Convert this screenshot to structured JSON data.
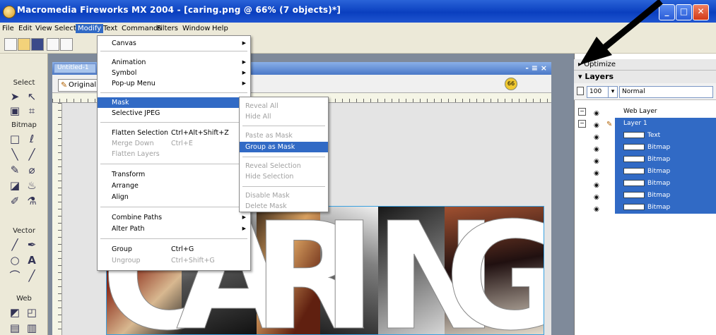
{
  "window": {
    "title": "Macromedia Fireworks MX 2004 - [caring.png @ 66% (7 objects)*]",
    "buttons": {
      "minimize": "_",
      "maximize": "□",
      "close": "✕"
    }
  },
  "menubar": [
    "File",
    "Edit",
    "View",
    "Select",
    "Modify",
    "Text",
    "Commands",
    "Filters",
    "Window",
    "Help"
  ],
  "tools": {
    "headings": {
      "select": "Select",
      "bitmap": "Bitmap",
      "vector": "Vector",
      "web": "Web"
    },
    "text_tool_glyph": "A"
  },
  "document": {
    "tab": "Untitled-1",
    "original_tab": "Original",
    "window_buttons": "- ≡ ×",
    "zoom_icon": "66",
    "artwork_text": [
      "C",
      "A",
      "R",
      "I",
      "N",
      "G"
    ]
  },
  "modify_menu": [
    {
      "label": "Canvas",
      "submenu": true
    },
    {
      "label": "Animation",
      "submenu": true
    },
    {
      "label": "Symbol",
      "submenu": true
    },
    {
      "label": "Pop-up Menu",
      "submenu": true
    },
    {
      "label": "Mask",
      "submenu": true,
      "highlighted": true
    },
    {
      "label": "Selective JPEG",
      "submenu": true
    },
    {
      "label": "Flatten Selection",
      "shortcut": "Ctrl+Alt+Shift+Z"
    },
    {
      "label": "Merge Down",
      "shortcut": "Ctrl+E",
      "disabled": true
    },
    {
      "label": "Flatten Layers",
      "disabled": true
    },
    {
      "label": "Transform",
      "submenu": true
    },
    {
      "label": "Arrange",
      "submenu": true
    },
    {
      "label": "Align",
      "submenu": true
    },
    {
      "label": "Combine Paths",
      "submenu": true
    },
    {
      "label": "Alter Path",
      "submenu": true
    },
    {
      "label": "Group",
      "shortcut": "Ctrl+G"
    },
    {
      "label": "Ungroup",
      "shortcut": "Ctrl+Shift+G",
      "disabled": true
    }
  ],
  "mask_menu": [
    {
      "label": "Reveal All",
      "disabled": true
    },
    {
      "label": "Hide All",
      "disabled": true
    },
    {
      "label": "Paste as Mask",
      "disabled": true
    },
    {
      "label": "Group as Mask",
      "highlighted": true
    },
    {
      "label": "Reveal Selection",
      "disabled": true
    },
    {
      "label": "Hide Selection",
      "disabled": true
    },
    {
      "label": "Disable Mask",
      "disabled": true
    },
    {
      "label": "Delete Mask",
      "disabled": true
    }
  ],
  "panels": {
    "optimize": "▸ Optimize",
    "layers": "▾ Layers",
    "opacity": "100",
    "blend_mode": "Normal"
  },
  "layers": [
    {
      "name": "Web Layer",
      "type": "web"
    },
    {
      "name": "Layer 1",
      "type": "layer"
    },
    {
      "name": "Text",
      "type": "object"
    },
    {
      "name": "Bitmap",
      "type": "object"
    },
    {
      "name": "Bitmap",
      "type": "object"
    },
    {
      "name": "Bitmap",
      "type": "object"
    },
    {
      "name": "Bitmap",
      "type": "object"
    },
    {
      "name": "Bitmap",
      "type": "object"
    },
    {
      "name": "Bitmap",
      "type": "object"
    }
  ],
  "colors": {
    "titlebar": "#0a3fbf",
    "highlight": "#316ac5",
    "chrome": "#ece9d8"
  }
}
